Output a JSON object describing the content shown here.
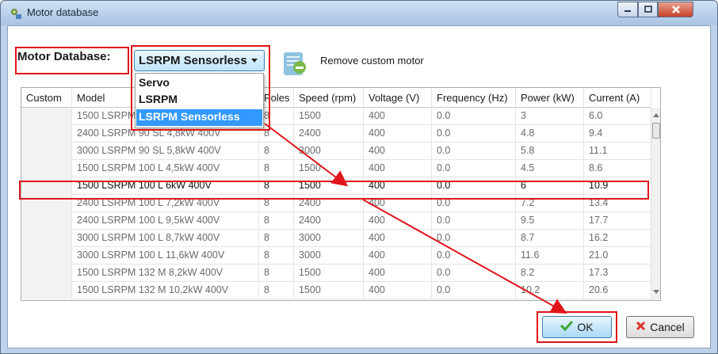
{
  "window": {
    "title": "Motor database"
  },
  "toolbar": {
    "db_label": "Motor Database:",
    "db_selected": "LSRPM Sensorless",
    "remove_label": "Remove custom motor"
  },
  "dropdown": {
    "options": [
      "Servo",
      "LSRPM",
      "LSRPM Sensorless"
    ],
    "highlighted_index": 2
  },
  "table": {
    "columns": [
      "Custom",
      "Model",
      "Poles",
      "Speed (rpm)",
      "Voltage (V)",
      "Frequency (Hz)",
      "Power (kW)",
      "Current (A)"
    ],
    "rows": [
      [
        "",
        "1500 LSRPM 90 SL 4,5kW 400V",
        "8",
        "1500",
        "400",
        "0.0",
        "3",
        "6.0"
      ],
      [
        "",
        "2400 LSRPM 90 SL 4,8kW 400V",
        "8",
        "2400",
        "400",
        "0.0",
        "4.8",
        "9.4"
      ],
      [
        "",
        "3000 LSRPM 90 SL 5,8kW 400V",
        "8",
        "3000",
        "400",
        "0.0",
        "5.8",
        "11.1"
      ],
      [
        "",
        "1500 LSRPM 100 L 4,5kW 400V",
        "8",
        "1500",
        "400",
        "0.0",
        "4.5",
        "8.6"
      ],
      [
        "",
        "1500 LSRPM 100 L 6kW 400V",
        "8",
        "1500",
        "400",
        "0.0",
        "6",
        "10.9"
      ],
      [
        "",
        "2400 LSRPM 100 L 7,2kW 400V",
        "8",
        "2400",
        "400",
        "0.0",
        "7.2",
        "13.4"
      ],
      [
        "",
        "2400 LSRPM 100 L 9,5kW 400V",
        "8",
        "2400",
        "400",
        "0.0",
        "9.5",
        "17.7"
      ],
      [
        "",
        "3000 LSRPM 100 L 8,7kW 400V",
        "8",
        "3000",
        "400",
        "0.0",
        "8.7",
        "16.2"
      ],
      [
        "",
        "3000 LSRPM 100 L 11,6kW 400V",
        "8",
        "3000",
        "400",
        "0.0",
        "11.6",
        "21.0"
      ],
      [
        "",
        "1500 LSRPM 132 M 8,2kW 400V",
        "8",
        "1500",
        "400",
        "0.0",
        "8.2",
        "17.3"
      ],
      [
        "",
        "1500 LSRPM 132 M 10,2kW 400V",
        "8",
        "1500",
        "400",
        "0.0",
        "10.2",
        "20.6"
      ]
    ],
    "selected_row": 4
  },
  "buttons": {
    "ok": "OK",
    "cancel": "Cancel"
  },
  "colors": {
    "annotation": "#e0161b",
    "selection_highlight": "#3399ff",
    "ok_check": "#3aa635",
    "cancel_x": "#d9342b"
  },
  "icons": {
    "app": "database-gear-icon",
    "remove": "remove-document-icon",
    "ok": "checkmark-icon",
    "cancel": "x-icon"
  }
}
